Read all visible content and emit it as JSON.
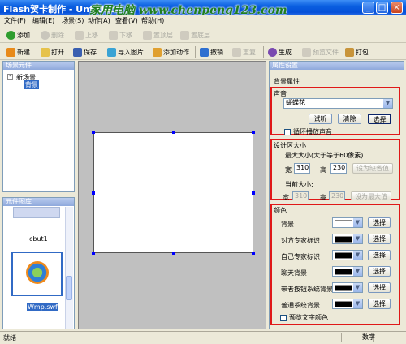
{
  "window": {
    "title": "Flash贺卡制作 - Untitled",
    "watermark": "家用电脑  www.chenpeng123.com"
  },
  "menu": [
    "文件(F)",
    "编辑(E)",
    "场景(S)",
    "动作(A)",
    "查看(V)",
    "帮助(H)"
  ],
  "toolbar1": [
    {
      "label": "添加",
      "icon": "add-icon",
      "enabled": true
    },
    {
      "label": "删除",
      "icon": "delete-icon",
      "enabled": false
    },
    {
      "label": "上移",
      "icon": "up-icon",
      "enabled": false
    },
    {
      "label": "下移",
      "icon": "down-icon",
      "enabled": false
    },
    {
      "label": "置顶层",
      "icon": "top-icon",
      "enabled": false
    },
    {
      "label": "置底层",
      "icon": "bottom-icon",
      "enabled": false
    }
  ],
  "toolbar2": [
    {
      "label": "新建",
      "icon": "new-icon",
      "enabled": true
    },
    {
      "label": "打开",
      "icon": "open-icon",
      "enabled": true
    },
    {
      "label": "保存",
      "icon": "save-icon",
      "enabled": true
    },
    {
      "label": "导入图片",
      "icon": "image-icon",
      "enabled": true
    },
    {
      "label": "添加动作",
      "icon": "action-icon",
      "enabled": true
    },
    {
      "label": "撤销",
      "icon": "undo-icon",
      "enabled": true
    },
    {
      "label": "重复",
      "icon": "redo-icon",
      "enabled": false
    },
    {
      "label": "生成",
      "icon": "build-icon",
      "enabled": true
    },
    {
      "label": "预览文件",
      "icon": "preview-icon",
      "enabled": false
    },
    {
      "label": "打包",
      "icon": "package-icon",
      "enabled": true
    }
  ],
  "scene_panel": {
    "title": "场景元件",
    "root": "新场景",
    "child": "背景"
  },
  "gallery_panel": {
    "title": "元件图库",
    "item1_label": "cbut1",
    "item2_label": "Wmp.swf"
  },
  "properties": {
    "title": "属性设置",
    "bg_prop_label": "背景属性",
    "sound": {
      "legend": "声音",
      "selected": "蝴蝶花",
      "btn_test": "试听",
      "btn_clear": "清除",
      "btn_select": "选择",
      "loop_label": "循环播放声音"
    },
    "size": {
      "legend": "设计区大小",
      "max_label": "最大大小(大于等于60像素)",
      "width_label": "宽",
      "width_value": "310",
      "height_label": "高",
      "height_value": "230",
      "btn_set_default": "设为缺省值",
      "current_label": "当前大小:",
      "cur_width_value": "310",
      "cur_height_value": "230",
      "btn_set_max": "设为最大值"
    },
    "colors": {
      "legend": "颜色",
      "rows": [
        {
          "label": "背景",
          "color": "#ffffff",
          "btn": "选择"
        },
        {
          "label": "对方专家标识",
          "color": "#000000",
          "btn": "选择"
        },
        {
          "label": "自己专家标识",
          "color": "#000000",
          "btn": "选择"
        },
        {
          "label": "聊天背景",
          "color": "#000000",
          "btn": "选择"
        },
        {
          "label": "带者按钮系统背景",
          "color": "#000000",
          "btn": "选择"
        },
        {
          "label": "普通系统背景",
          "color": "#000000",
          "btn": "选择"
        }
      ],
      "preview_label": "预览文字颜色"
    }
  },
  "status": {
    "left": "就绪",
    "right": "数字"
  }
}
